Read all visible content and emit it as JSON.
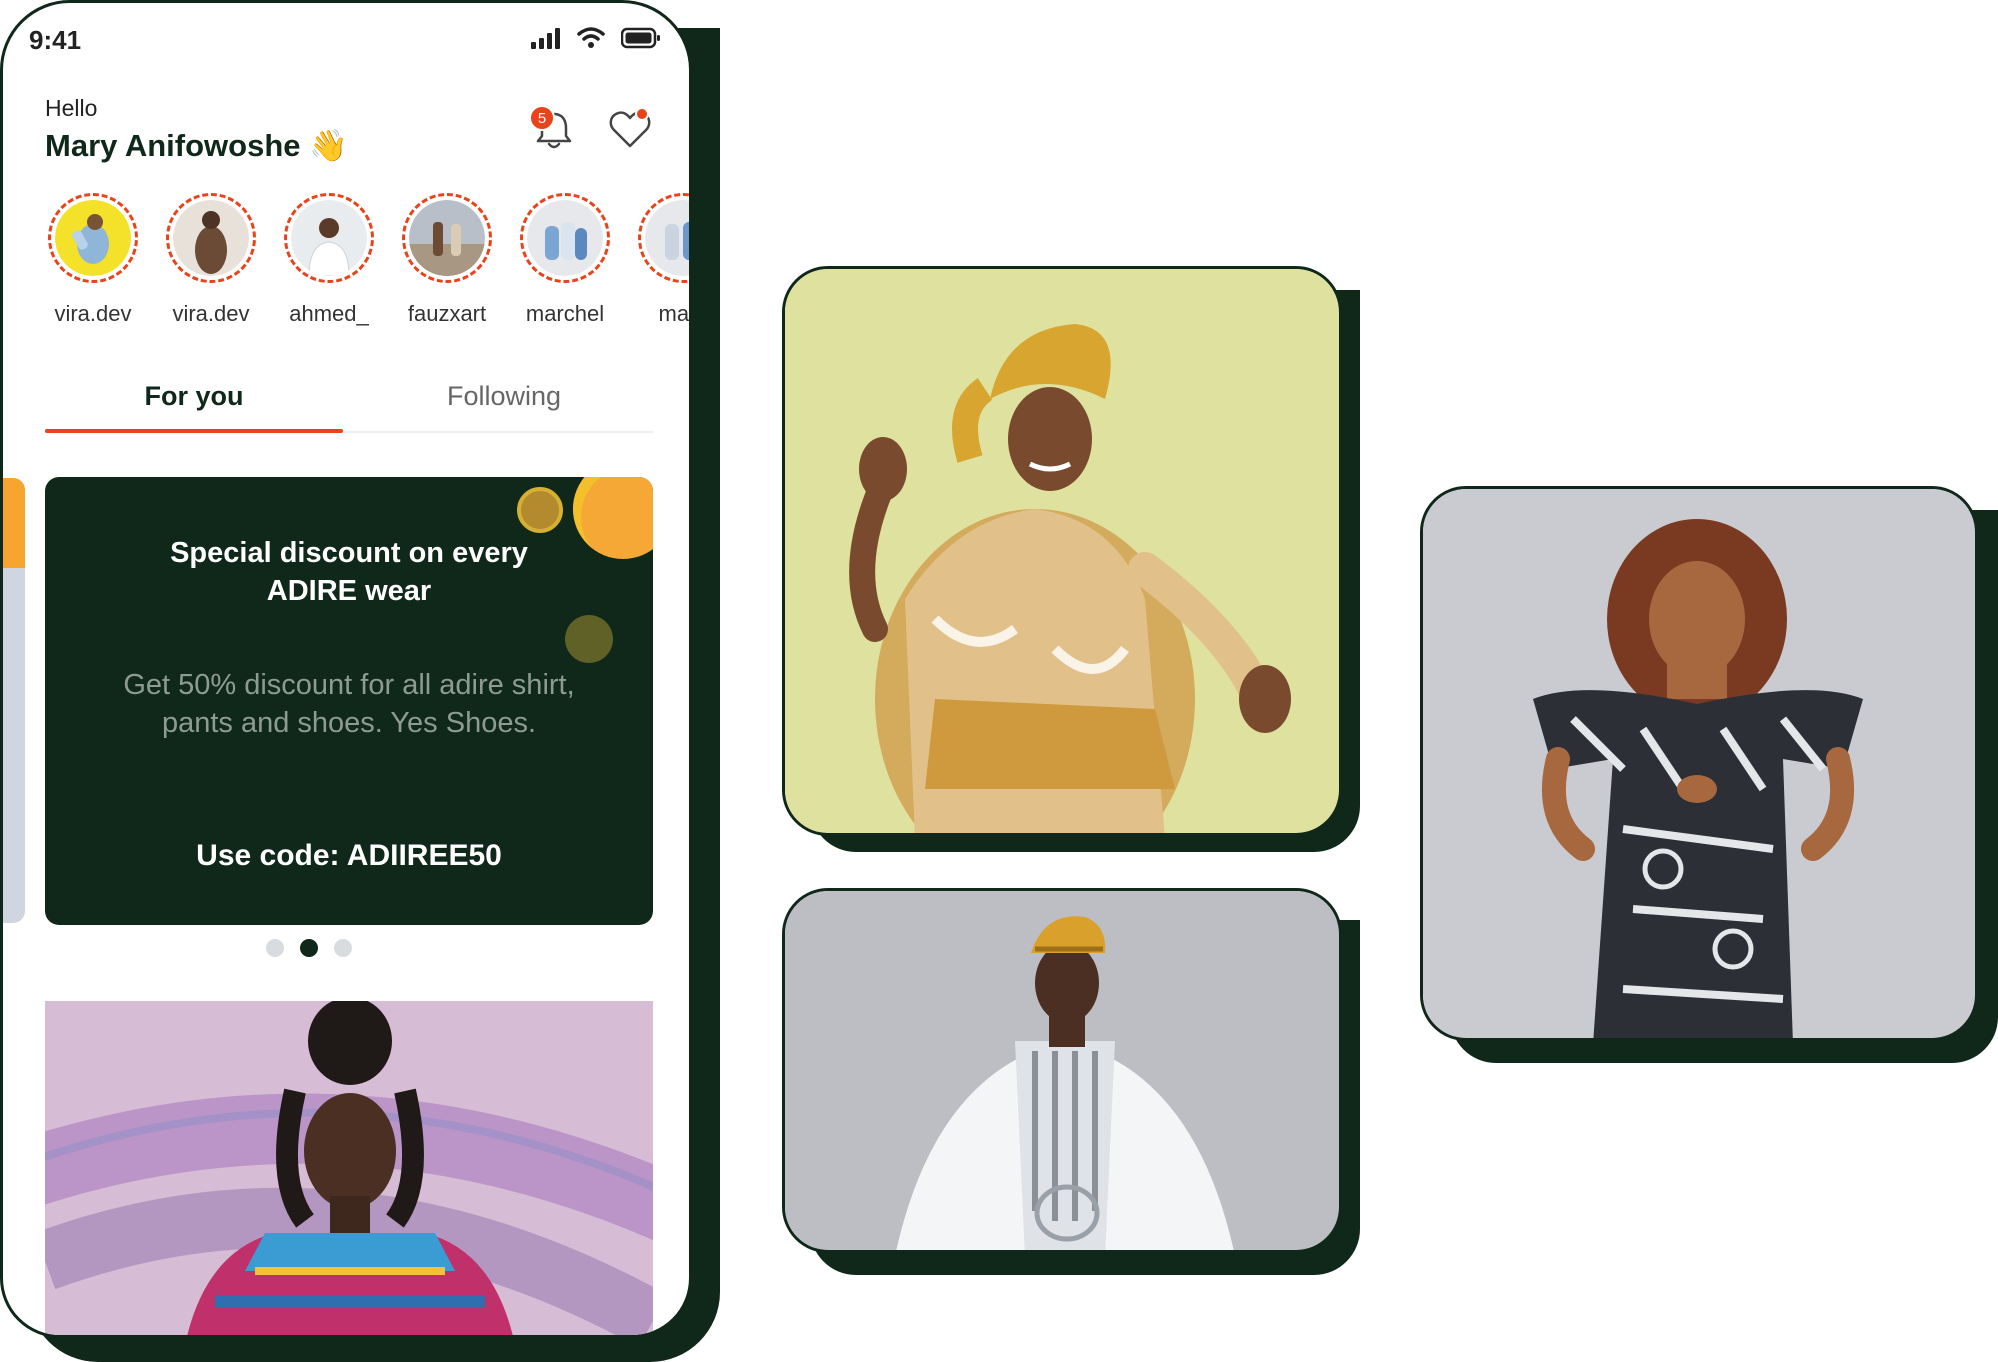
{
  "status_bar": {
    "time": "9:41"
  },
  "header": {
    "hello": "Hello",
    "name": "Mary Anifowoshe 👋",
    "notification_count": "5"
  },
  "stories": [
    {
      "label": "vira.dev"
    },
    {
      "label": "vira.dev"
    },
    {
      "label": "ahmed_"
    },
    {
      "label": "fauzxart"
    },
    {
      "label": "marchel"
    },
    {
      "label": "marc"
    }
  ],
  "tabs": [
    {
      "label": "For you",
      "active": true
    },
    {
      "label": "Following",
      "active": false
    }
  ],
  "promo": {
    "title": "Special  discount on every\nADIRE wear",
    "body": "Get 50% discount for all adire shirt, pants and shoes. Yes Shoes.",
    "code": "Use code: ADIIREE50"
  },
  "carousel": {
    "pages": 3,
    "active_page": 2
  },
  "colors": {
    "brand_dark": "#10281a",
    "accent": "#e8431b",
    "coin": "#f5a836"
  }
}
